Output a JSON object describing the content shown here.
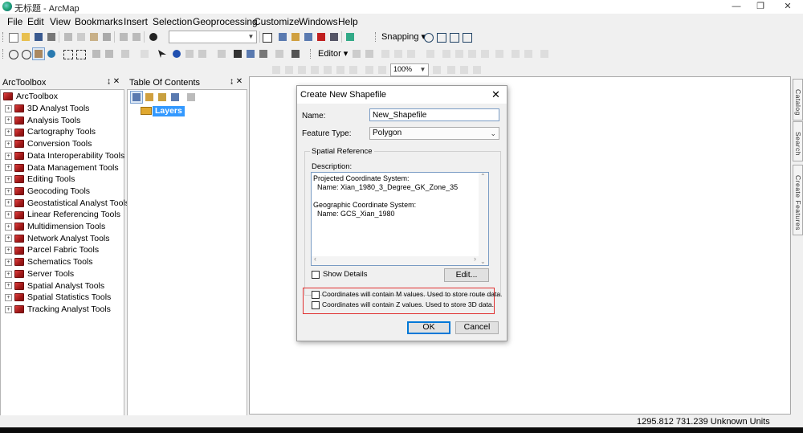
{
  "app": {
    "window_title": "无标题 - ArcMap",
    "win_buttons": {
      "minimize": "—",
      "restore": "❐",
      "close": "✕"
    }
  },
  "menubar": [
    "File",
    "Edit",
    "View",
    "Bookmarks",
    "Insert",
    "Selection",
    "Geoprocessing",
    "Customize",
    "Windows",
    "Help"
  ],
  "toolbar": {
    "snapping_label": "Snapping ▾",
    "editor_label": "Editor ▾",
    "zoom_value": "100%"
  },
  "arctoolbox": {
    "title": "ArcToolbox",
    "pin": "↨ ✕",
    "root": "ArcToolbox",
    "items": [
      "3D Analyst Tools",
      "Analysis Tools",
      "Cartography Tools",
      "Conversion Tools",
      "Data Interoperability Tools",
      "Data Management Tools",
      "Editing Tools",
      "Geocoding Tools",
      "Geostatistical Analyst Tools",
      "Linear Referencing Tools",
      "Multidimension Tools",
      "Network Analyst Tools",
      "Parcel Fabric Tools",
      "Schematics Tools",
      "Server Tools",
      "Spatial Analyst Tools",
      "Spatial Statistics Tools",
      "Tracking Analyst Tools"
    ]
  },
  "toc": {
    "title": "Table Of Contents",
    "pin": "↨ ✕",
    "layer": "Layers"
  },
  "dialog": {
    "title": "Create New Shapefile",
    "close": "✕",
    "name_label": "Name:",
    "name_value": "New_Shapefile",
    "feature_type_label": "Feature Type:",
    "feature_type_value": "Polygon",
    "spatial_reference_label": "Spatial Reference",
    "description_label": "Description:",
    "description_lines": [
      "Projected Coordinate System:",
      "  Name: Xian_1980_3_Degree_GK_Zone_35",
      "",
      "Geographic Coordinate System:",
      "  Name: GCS_Xian_1980"
    ],
    "show_details_label": "Show Details",
    "edit_button": "Edit...",
    "m_values_label": "Coordinates will contain M values. Used to store route data.",
    "z_values_label": "Coordinates will contain Z values. Used to store 3D data.",
    "ok_button": "OK",
    "cancel_button": "Cancel"
  },
  "right_dock": [
    "Catalog",
    "Search",
    "Create Features"
  ],
  "statusbar": {
    "coordinates": "1295.812  731.239 Unknown Units"
  },
  "colors": {
    "highlight_box": "#e03030",
    "selection": "#3399ff",
    "toolbox_red": "#c02020"
  }
}
